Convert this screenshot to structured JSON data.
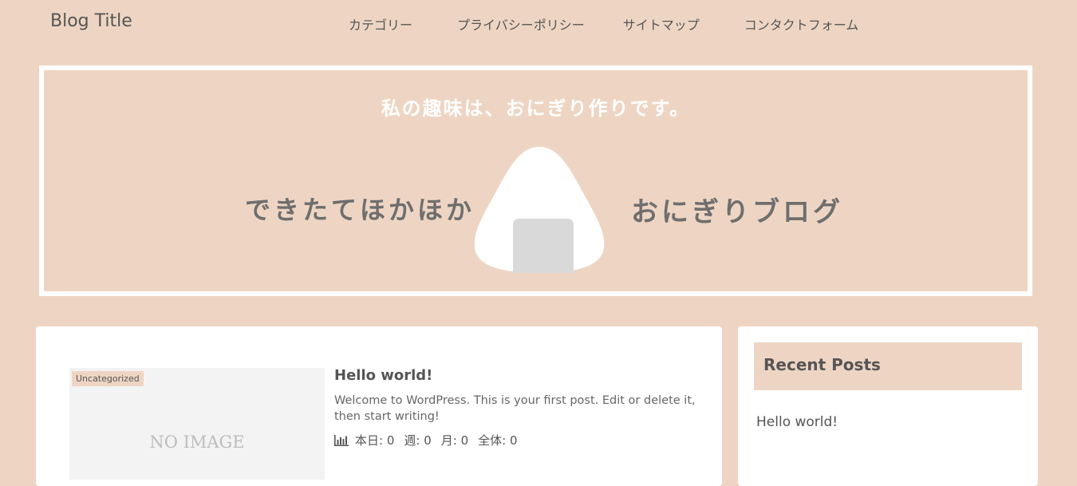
{
  "header": {
    "site_title": "Blog Title",
    "nav": [
      {
        "label": "カテゴリー"
      },
      {
        "label": "プライバシーポリシー"
      },
      {
        "label": "サイトマップ"
      },
      {
        "label": "コンタクトフォーム"
      }
    ]
  },
  "banner": {
    "tagline": "私の趣味は、おにぎり作りです。",
    "left_text": "できたてほかほか",
    "right_text": "おにぎりブログ"
  },
  "post": {
    "category": "Uncategorized",
    "thumbnail_text": "NO IMAGE",
    "title": "Hello world!",
    "excerpt": "Welcome to WordPress. This is your first post. Edit or delete it, then start writing!",
    "stats": {
      "today": "本日: 0",
      "week": "週: 0",
      "month": "月: 0",
      "total": "全体: 0"
    }
  },
  "sidebar": {
    "widget_title": "Recent Posts",
    "recent_posts": [
      {
        "title": "Hello world!"
      }
    ]
  },
  "colors": {
    "background": "#eed5c3",
    "card": "#ffffff",
    "text": "#555555",
    "banner_text": "#6e6e6e"
  },
  "icons": {
    "stats": "bar-chart-icon",
    "banner_image": "onigiri-icon"
  }
}
